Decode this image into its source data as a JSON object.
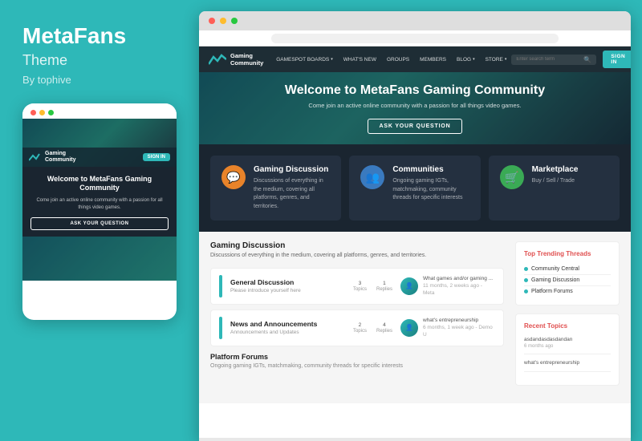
{
  "left": {
    "title": "MetaFans",
    "subtitle": "Theme",
    "author": "By tophive"
  },
  "mobile": {
    "dots": [
      "red",
      "yellow",
      "green"
    ],
    "hero_text": "Welcome to MetaFans Gaming Community",
    "hero_sub": "Come join an active online community with a passion for all things video games.",
    "cta": "ASK YOUR QUESTION",
    "logo_text": "Gaming\nCommunity",
    "signin": "SIGN IN"
  },
  "browser": {
    "dots": [
      "red",
      "yellow",
      "green"
    ]
  },
  "nav": {
    "logo_text": "Gaming\nCommunity",
    "links": [
      {
        "label": "GAMESPOT BOARDS",
        "has_arrow": true
      },
      {
        "label": "WHAT'S NEW",
        "has_arrow": false
      },
      {
        "label": "GROUPS",
        "has_arrow": false
      },
      {
        "label": "MEMBERS",
        "has_arrow": false
      },
      {
        "label": "BLOG",
        "has_arrow": true
      },
      {
        "label": "STORE",
        "has_arrow": true
      }
    ],
    "search_placeholder": "Enter search term",
    "signin": "SIGN IN"
  },
  "hero": {
    "title": "Welcome to MetaFans Gaming Community",
    "subtitle": "Come join an active online community with a passion for all things video games.",
    "cta": "ASK YOUR QUESTION"
  },
  "categories": [
    {
      "icon": "💬",
      "color": "orange",
      "title": "Gaming Discussion",
      "desc": "Discussions of everything in the medium, covering all platforms, genres, and territories."
    },
    {
      "icon": "👥",
      "color": "blue",
      "title": "Communities",
      "desc": "Ongoing gaming IGTs, matchmaking, community threads for specific interests"
    },
    {
      "icon": "🛒",
      "color": "green",
      "title": "Marketplace",
      "desc": "Buy / Sell / Trade"
    }
  ],
  "forums_section": {
    "title": "Gaming Discussion",
    "desc": "Discussions of everything in the medium, covering all platforms, genres, and territories.",
    "forums": [
      {
        "name": "General Discussion",
        "meta": "Please introduce yourself here",
        "topics": "3",
        "replies": "1",
        "activity_title": "What games and/or gaming ...",
        "activity_time": "11 months, 2 weeks ago - Meta"
      },
      {
        "name": "News and Announcements",
        "meta": "Announcements and Updates",
        "topics": "2",
        "replies": "4",
        "activity_title": "what's entrepreneurship",
        "activity_time": "6 months, 1 week ago - Demo U"
      }
    ],
    "platform_title": "Platform Forums",
    "platform_desc": "Ongoing gaming IGTs, matchmaking, community threads for specific interests"
  },
  "sidebar": {
    "trending_title": "Top Trending Threads",
    "trending_items": [
      "Community Central",
      "Gaming Discussion",
      "Platform Forums"
    ],
    "recent_title": "Recent Topics",
    "recent_items": [
      {
        "text": "asdandasdasdandan",
        "time": "6 months ago"
      },
      {
        "text": "what's entrepreneurship",
        "time": ""
      }
    ]
  }
}
